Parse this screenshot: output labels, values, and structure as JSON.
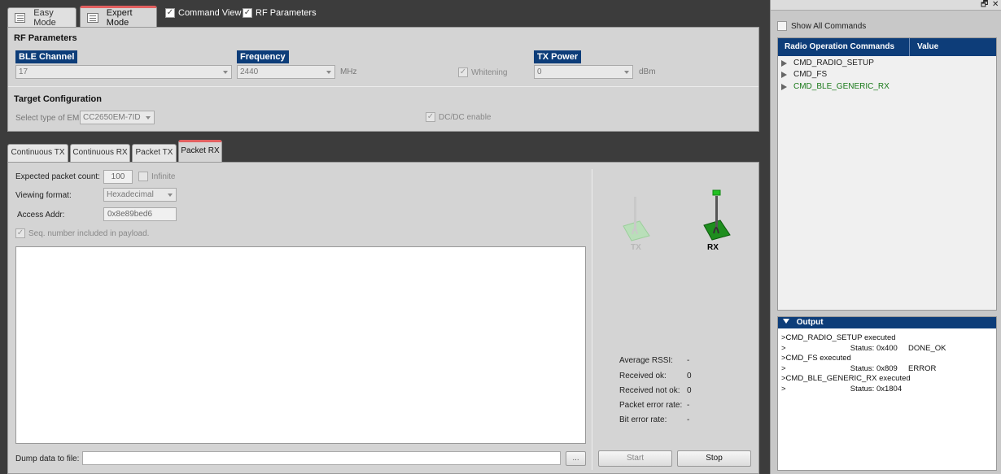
{
  "top": {
    "easy_mode": "Easy Mode",
    "expert_mode": "Expert Mode",
    "command_view": "Command View",
    "rf_parameters": "RF Parameters"
  },
  "rf": {
    "title": "RF Parameters",
    "ble_channel_label": "BLE Channel",
    "ble_channel_value": "17",
    "frequency_label": "Frequency",
    "frequency_value": "2440",
    "frequency_unit": "MHz",
    "whitening": "Whitening",
    "tx_power_label": "TX Power",
    "tx_power_value": "0",
    "tx_power_unit": "dBm"
  },
  "target": {
    "title": "Target Configuration",
    "select_em_label": "Select type of EM",
    "em_value": "CC2650EM-7ID",
    "dcdc": "DC/DC enable"
  },
  "tabs": [
    "Continuous TX",
    "Continuous RX",
    "Packet TX",
    "Packet RX"
  ],
  "packet_rx": {
    "expected_count_label": "Expected packet count:",
    "expected_count_value": "100",
    "infinite": "Infinite",
    "viewing_format_label": "Viewing format:",
    "viewing_format_value": "Hexadecimal",
    "access_addr_label": "Access Addr:",
    "access_addr_value": "0x8e89bed6",
    "seq_number": "Seq. number included in payload.",
    "dump_label": "Dump data to file:",
    "browse": "...",
    "tx_label": "TX",
    "rx_label": "RX",
    "start": "Start",
    "stop": "Stop"
  },
  "stats": [
    {
      "label": "Average RSSI:",
      "value": "-"
    },
    {
      "label": "Received ok:",
      "value": "0"
    },
    {
      "label": "Received not ok:",
      "value": "0"
    },
    {
      "label": "Packet error rate:",
      "value": "-"
    },
    {
      "label": "Bit error rate:",
      "value": "-"
    }
  ],
  "right": {
    "show_all": "Show All Commands",
    "col_commands": "Radio Operation Commands",
    "col_value": "Value",
    "commands": [
      {
        "name": "CMD_RADIO_SETUP"
      },
      {
        "name": "CMD_FS"
      },
      {
        "name": "CMD_BLE_GENERIC_RX"
      }
    ],
    "output_title": "Output",
    "output_lines": [
      ">CMD_RADIO_SETUP executed",
      ">                              Status: 0x400     DONE_OK",
      ">CMD_FS executed",
      ">                              Status: 0x809     ERROR",
      ">CMD_BLE_GENERIC_RX executed",
      ">                              Status: 0x1804"
    ]
  },
  "colors": {
    "accent_blue": "#0d3d79",
    "active_tab_red": "#e26060",
    "active_command_green": "#1a7a1a",
    "rx_indicator": "#22c022"
  }
}
